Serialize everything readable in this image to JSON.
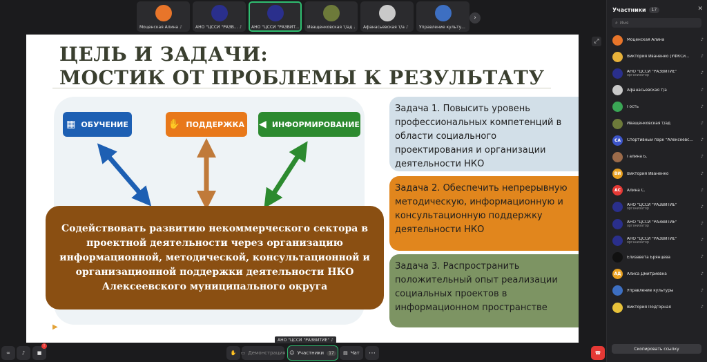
{
  "thumbnails": [
    {
      "name": "Моценская Алина",
      "initials": "",
      "color": "#e8752a",
      "active": false
    },
    {
      "name": "АНО \"ЦССИ \"РАЗВ...",
      "initials": "",
      "color": "#2a2f8c",
      "active": false
    },
    {
      "name": "АНО \"ЦССИ \"РАЗВИТ...",
      "initials": "",
      "color": "#2a2f8c",
      "active": true
    },
    {
      "name": "Иващенковская т/ад",
      "initials": "",
      "color": "#6d7a3a",
      "active": false
    },
    {
      "name": "Афанасьевская т/а",
      "initials": "",
      "color": "#c9c9c9",
      "active": false
    },
    {
      "name": "Управление культу...",
      "initials": "",
      "color": "#3d6fc2",
      "active": false
    }
  ],
  "slide": {
    "title_line1": "ЦЕЛЬ И ЗАДАЧИ:",
    "title_line2": "МОСТИК ОТ ПРОБЛЕМЫ К РЕЗУЛЬТАТУ",
    "tag_education": "ОБУЧЕНИЕ",
    "tag_support": "ПОДДЕРЖКА",
    "tag_inform": "ИНФОРМИРОВАНИЕ",
    "goal": "Содействовать развитию некоммерческого сектора в проектной деятельности через организацию информационной, методической, консультационной и организационной поддержки деятельности НКО Алексеевского муниципального округа",
    "task1": "Задача 1. Повысить уровень профессиональных компетенций в области социального проектирования и организации деятельности НКО",
    "task2": "Задача 2. Обеспечить непрерывную методическую, информационную и консультационную поддержку деятельности НКО",
    "task3": "Задача 3. Распространить положительный опыт реализации социальных проектов в информационном пространстве"
  },
  "presenter_label": "АНО \"ЦССИ \"РАЗВИТИЕ\"",
  "panel": {
    "title": "Участники",
    "count": "17",
    "search_placeholder": "Имя",
    "participants": [
      {
        "name": "Моценская Алина",
        "role": "",
        "initials": "",
        "color": "#e8752a"
      },
      {
        "name": "Виктория Иваненко (УФКСи...",
        "role": "",
        "initials": "",
        "color": "#e8b23a"
      },
      {
        "name": "АНО \"ЦССИ \"РАЗВИТИЕ\"",
        "role": "организатор",
        "initials": "",
        "color": "#2a2f8c"
      },
      {
        "name": "Афанасьевская т/а",
        "role": "",
        "initials": "",
        "color": "#c9c9c9"
      },
      {
        "name": "Гость",
        "role": "",
        "initials": "",
        "color": "#3aa655"
      },
      {
        "name": "Иващенковская т/ад",
        "role": "",
        "initials": "",
        "color": "#6d7a3a"
      },
      {
        "name": "Спортивный парк \"Алексеевс...",
        "role": "",
        "initials": "СА",
        "color": "#3d55c9"
      },
      {
        "name": "Галина Б.",
        "role": "",
        "initials": "",
        "color": "#9c6b4a"
      },
      {
        "name": "Виктория Иваненко",
        "role": "",
        "initials": "ВИ",
        "color": "#e8a020"
      },
      {
        "name": "Алина С.",
        "role": "",
        "initials": "АС",
        "color": "#e53935"
      },
      {
        "name": "АНО \"ЦССИ \"РАЗВИТИЕ\"",
        "role": "организатор",
        "initials": "",
        "color": "#2a2f8c"
      },
      {
        "name": "АНО \"ЦССИ \"РАЗВИТИЕ\"",
        "role": "организатор",
        "initials": "",
        "color": "#2a2f8c"
      },
      {
        "name": "АНО \"ЦССИ \"РАЗВИТИЕ\"",
        "role": "организатор",
        "initials": "",
        "color": "#2a2f8c"
      },
      {
        "name": "Елизавета Брянцева",
        "role": "",
        "initials": "",
        "color": "#111111"
      },
      {
        "name": "Алиса Дмитриевна",
        "role": "",
        "initials": "АД",
        "color": "#e8a020"
      },
      {
        "name": "Управление культуры",
        "role": "",
        "initials": "",
        "color": "#3d6fc2"
      },
      {
        "name": "Виктория Подгорная",
        "role": "",
        "initials": "",
        "color": "#e8c23a"
      }
    ],
    "copy_link": "Скопировать ссылку"
  },
  "toolbar": {
    "demo": "Демонстрация",
    "participants": "Участники",
    "participants_count": "17",
    "chat": "Чат",
    "camera_badge": "!"
  },
  "colors": {
    "accent_green": "#2fbf71",
    "leave_red": "#e53935",
    "task1_bg": "#d2dfe8",
    "task2_bg": "#e1861d",
    "task3_bg": "#7d9463",
    "goal_bg": "#8a4f12"
  }
}
